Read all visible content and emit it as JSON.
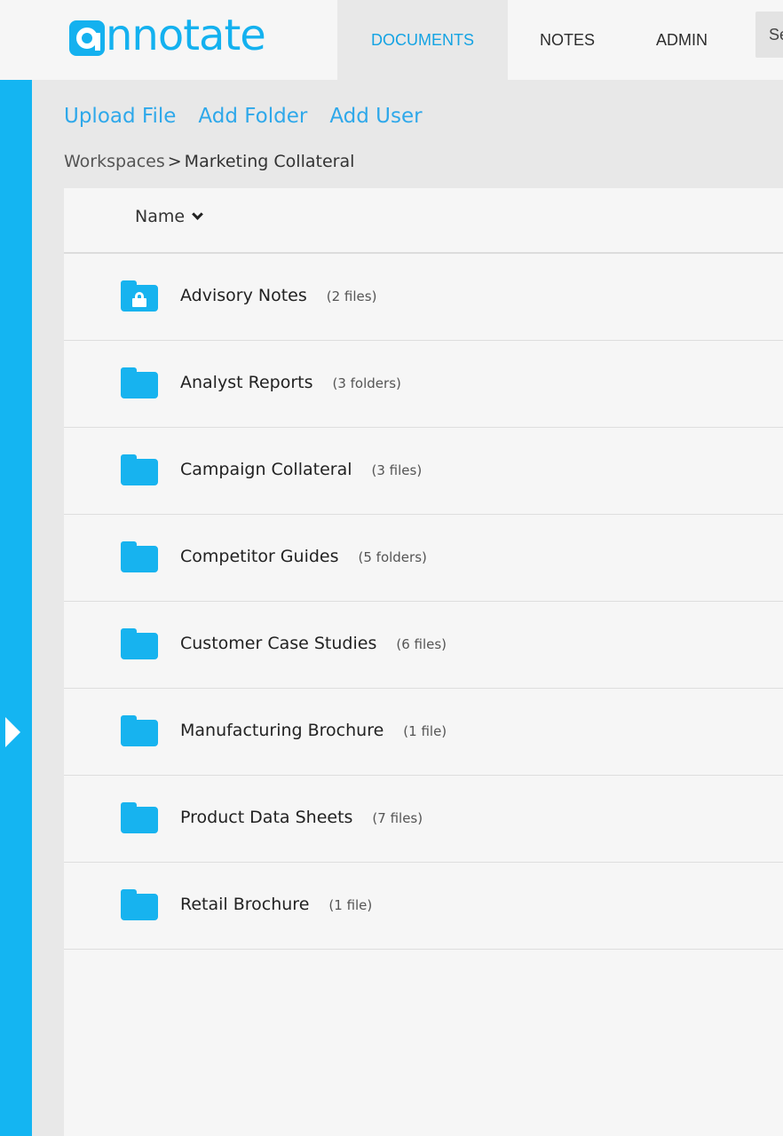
{
  "app": {
    "logo_text": "nnotate",
    "brand_color": "#14b1ef"
  },
  "nav": {
    "documents": "DOCUMENTS",
    "notes": "NOTES",
    "admin": "ADMIN",
    "search_partial": "Se"
  },
  "actions": {
    "upload_file": "Upload File",
    "add_folder": "Add Folder",
    "add_user": "Add User"
  },
  "breadcrumb": {
    "root": "Workspaces",
    "separator": ">",
    "current": "Marketing Collateral"
  },
  "table": {
    "sort_label": "Name",
    "sort_icon": "chevron-down-icon",
    "rows": [
      {
        "name": "Advisory Notes",
        "count": "(2 files)",
        "icon": "locked-folder-icon"
      },
      {
        "name": "Analyst Reports",
        "count": "(3 folders)",
        "icon": "folder-icon"
      },
      {
        "name": "Campaign Collateral",
        "count": "(3 files)",
        "icon": "folder-icon"
      },
      {
        "name": "Competitor Guides",
        "count": "(5 folders)",
        "icon": "folder-icon"
      },
      {
        "name": "Customer Case Studies",
        "count": "(6 files)",
        "icon": "folder-icon"
      },
      {
        "name": "Manufacturing Brochure",
        "count": "(1 file)",
        "icon": "folder-icon"
      },
      {
        "name": "Product Data Sheets",
        "count": "(7 files)",
        "icon": "folder-icon"
      },
      {
        "name": "Retail Brochure",
        "count": "(1 file)",
        "icon": "folder-icon"
      }
    ]
  },
  "sidebar": {
    "toggle_icon": "expand-arrow-icon"
  }
}
